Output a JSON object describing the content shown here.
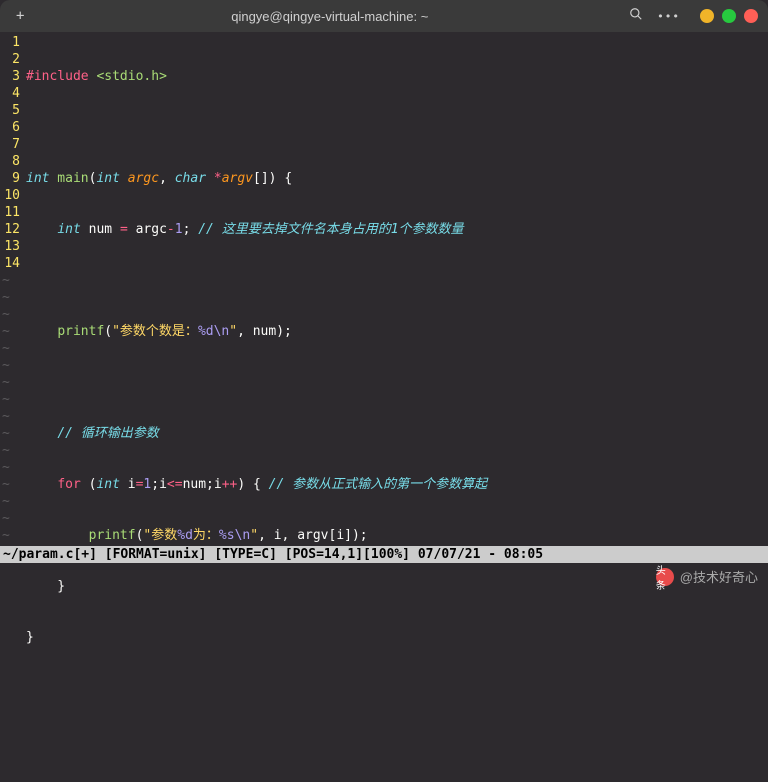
{
  "titlebar": {
    "title": "qingye@qingye-virtual-machine: ~"
  },
  "code": {
    "l1": {
      "preproc": "#include ",
      "inc": "<stdio.h>"
    },
    "l3": {
      "t1": "int",
      "f": " main",
      "p": "(",
      "t2": "int",
      "a1": " argc",
      "c": ",",
      "t3": " char",
      "op": " *",
      "a2": "argv",
      "br": "[]) {"
    },
    "l4": {
      "ind": "    ",
      "t": "int",
      "v": " num ",
      "op": "=",
      "e": " argc",
      "op2": "-",
      "n": "1",
      "sc": ";",
      "cm": " // 这里要去掉文件名本身占用的1个参数数量"
    },
    "l6": {
      "ind": "    ",
      "f": "printf",
      "p": "(",
      "s1": "\"参数个数是：",
      "esc": "%d\\n",
      "s2": "\"",
      "c": ", num);"
    },
    "l8": {
      "ind": "    ",
      "cm": "// 循环输出参数"
    },
    "l9": {
      "ind": "    ",
      "kw": "for",
      "p": " (",
      "t": "int",
      "v": " i",
      "op": "=",
      "n": "1",
      "sc": ";i",
      "op2": "<=",
      "e2": "num;i",
      "op3": "++",
      "e3": ") { ",
      "cm": "// 参数从正式输入的第一个参数算起"
    },
    "l10": {
      "ind": "        ",
      "f": "printf",
      "p": "(",
      "s1": "\"参数",
      "esc1": "%d",
      "s2": "为：",
      "esc2": "%s\\n",
      "s3": "\"",
      "c": ", i, argv[i]);"
    },
    "l11": {
      "ind": "    }"
    },
    "l12": {
      "txt": "}"
    }
  },
  "lines": [
    "1",
    "2",
    "3",
    "4",
    "5",
    "6",
    "7",
    "8",
    "9",
    "10",
    "11",
    "12",
    "13",
    "14"
  ],
  "status": {
    "file": "~/param.c[+]",
    "format": " [FORMAT=unix]",
    "type": " [TYPE=C]",
    "pos": " [POS=14,1]",
    "pct": "[100%]",
    "date": " 07/07/21 - 08:05"
  },
  "watermark": {
    "logo": "头条",
    "text": "@技术好奇心"
  }
}
